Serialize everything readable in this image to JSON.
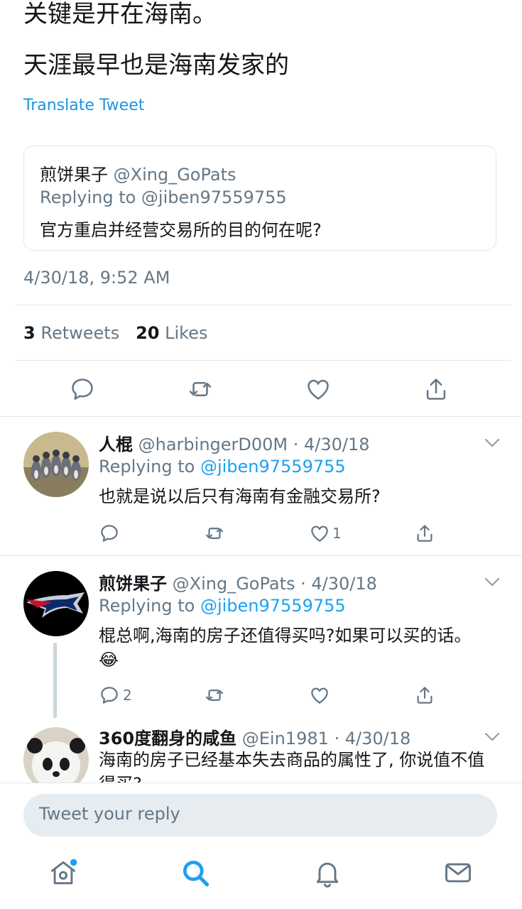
{
  "tweet": {
    "line1": "关键是开在海南。",
    "line2": "天涯最早也是海南发家的",
    "translate_label": "Translate Tweet",
    "timestamp": "4/30/18, 9:52 AM"
  },
  "quoted": {
    "name": "煎饼果子",
    "handle": "@Xing_GoPats",
    "replying": "Replying to @jiben97559755",
    "text": "官方重启并经营交易所的目的何在呢?"
  },
  "stats": {
    "retweets_count": "3",
    "retweets_label": "Retweets",
    "likes_count": "20",
    "likes_label": "Likes"
  },
  "replies": [
    {
      "name": "人棍",
      "meta": "@harbingerD00M · 4/30/18",
      "replying_prefix": "Replying to ",
      "replying_handle": "@jiben97559755",
      "text": "也就是说以后只有海南有金融交易所?",
      "like_count": "1"
    },
    {
      "name": "煎饼果子",
      "meta": "@Xing_GoPats · 4/30/18",
      "replying_prefix": "Replying to ",
      "replying_handle": "@jiben97559755",
      "text": "棍总啊,海南的房子还值得买吗?如果可以买的话。",
      "emoji": "😂",
      "reply_count": "2"
    },
    {
      "name": "360度翻身的咸鱼",
      "meta": "@Ein1981 · 4/30/18",
      "text": "海南的房子已经基本失去商品的属性了, 你说值不值得买?"
    }
  ],
  "compose": {
    "placeholder": "Tweet your reply"
  },
  "colors": {
    "accent": "#1da1f2",
    "secondary_text": "#657786",
    "border": "#e1e8ed"
  },
  "icons": [
    "reply-icon",
    "retweet-icon",
    "like-icon",
    "share-icon",
    "chevron-down-icon",
    "home-icon",
    "search-icon",
    "notifications-icon",
    "messages-icon"
  ]
}
